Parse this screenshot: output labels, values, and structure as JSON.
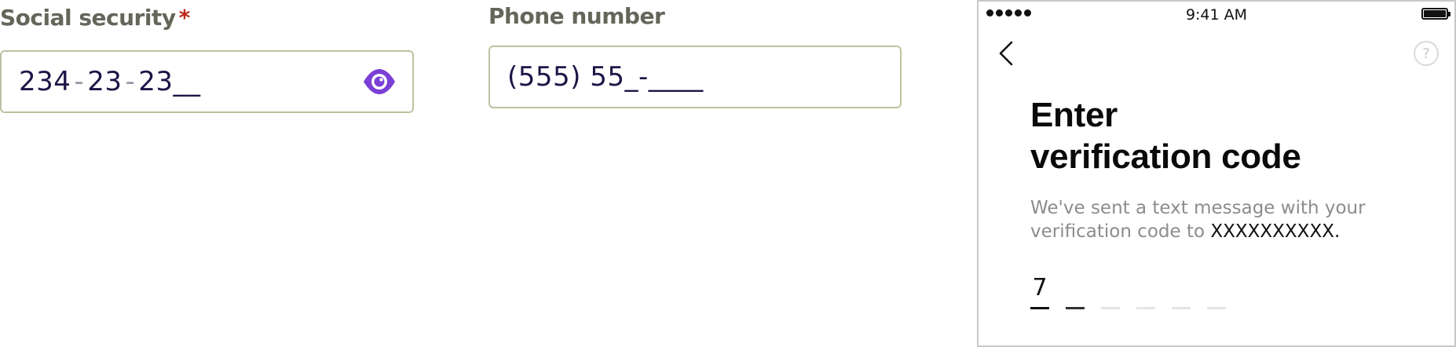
{
  "ssn_field": {
    "label": "Social security",
    "required_marker": "*",
    "value_parts": [
      "234",
      "23",
      "23__"
    ],
    "separator": "-",
    "toggle_icon": "eye-icon",
    "accent_color": "#7b3fd6"
  },
  "phone_field": {
    "label": "Phone number",
    "value": "(555) 55_-____"
  },
  "phone_screen": {
    "status_bar": {
      "signal_dots": 5,
      "time": "9:41 AM",
      "battery_icon": "battery-icon"
    },
    "back_icon": "chevron-left-icon",
    "help_label": "?",
    "heading_line1": "Enter",
    "heading_line2": "verification code",
    "subtext": "We've sent a text message with your verification code to ",
    "destination": "XXXXXXXXXX.",
    "code_digits": [
      "7",
      "",
      "",
      "",
      "",
      ""
    ]
  }
}
